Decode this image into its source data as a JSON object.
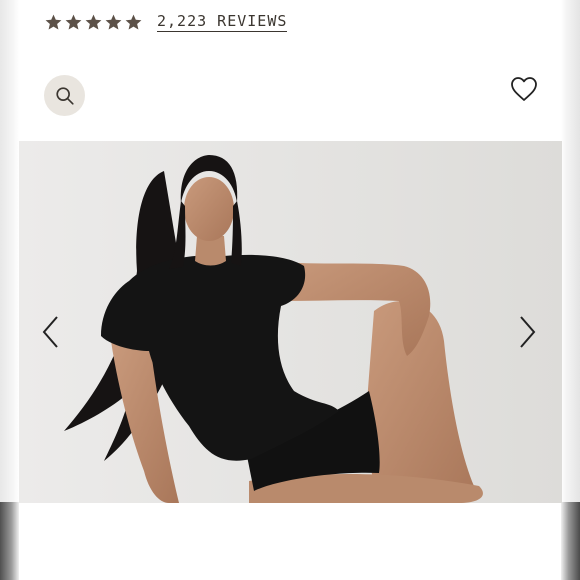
{
  "reviews": {
    "rating": 5,
    "max_rating": 5,
    "count_label": "2,223 REVIEWS"
  },
  "icons": {
    "star": "star-icon",
    "zoom": "magnifier-icon",
    "wishlist": "heart-icon",
    "prev": "chevron-left-icon",
    "next": "chevron-right-icon"
  },
  "colors": {
    "star": "#5c5148",
    "text": "#3b3630",
    "zoom_bg": "#e9e5df"
  }
}
